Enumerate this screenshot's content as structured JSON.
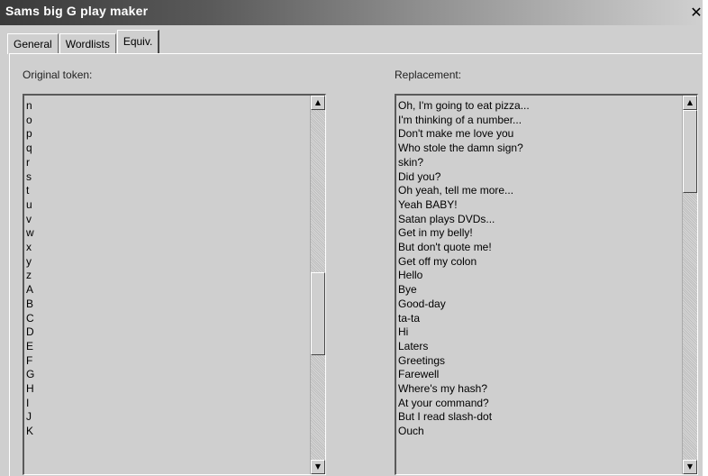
{
  "window": {
    "title": "Sams big G play maker",
    "close_glyph": "✕"
  },
  "tabs": [
    {
      "label": "General",
      "active": false
    },
    {
      "label": "Wordlists",
      "active": false
    },
    {
      "label": "Equiv.",
      "active": true
    }
  ],
  "original": {
    "label": "Original token:",
    "items": [
      "n",
      "o",
      "p",
      "q",
      "r",
      "s",
      "t",
      "u",
      "v",
      "w",
      "x",
      "y",
      "z",
      "A",
      "B",
      "C",
      "D",
      "E",
      "F",
      "G",
      "H",
      "I",
      "J",
      "K"
    ],
    "scroll_up_glyph": "▲",
    "scroll_down_glyph": "▼"
  },
  "replacement": {
    "label": "Replacement:",
    "items": [
      "Oh, I'm going to eat pizza...",
      "I'm thinking of a number...",
      "Don't make me love you",
      "Who stole the damn sign?",
      "skin?",
      "Did you?",
      "Oh yeah, tell me more...",
      "Yeah BABY!",
      "Satan plays DVDs...",
      "Get in my belly!",
      "But don't quote me!",
      "Get off my colon",
      "Hello",
      "Bye",
      "Good-day",
      "ta-ta",
      "Hi",
      "Laters",
      "Greetings",
      "Farewell",
      "Where's my hash?",
      "At your command?",
      "But I read slash-dot",
      "Ouch"
    ],
    "scroll_up_glyph": "▲",
    "scroll_down_glyph": "▼"
  },
  "colors": {
    "window_bg": "#cfcfcf",
    "titlebar_start": "#3a3a3a",
    "titlebar_end": "#d0d0d0"
  }
}
